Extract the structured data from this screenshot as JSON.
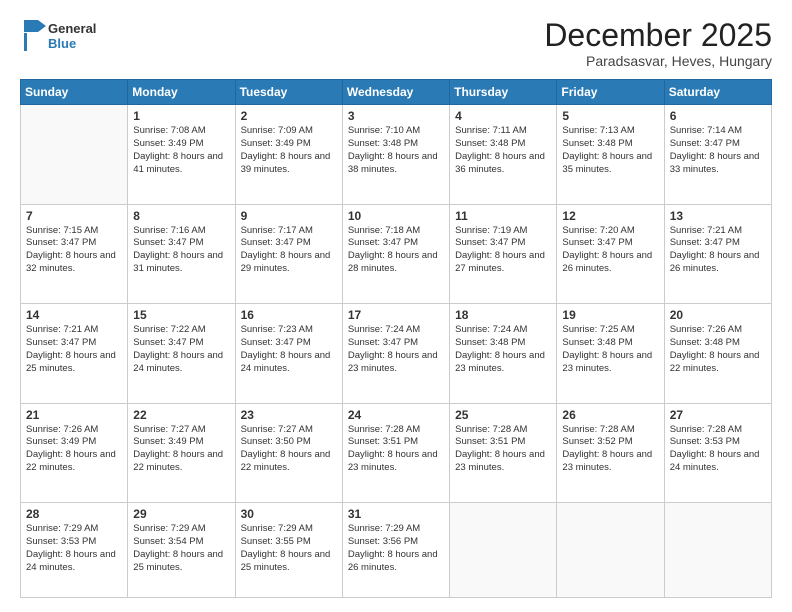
{
  "header": {
    "logo_line1": "General",
    "logo_line2": "Blue",
    "month": "December 2025",
    "location": "Paradsasvar, Heves, Hungary"
  },
  "weekdays": [
    "Sunday",
    "Monday",
    "Tuesday",
    "Wednesday",
    "Thursday",
    "Friday",
    "Saturday"
  ],
  "weeks": [
    [
      {
        "day": "",
        "sunrise": "",
        "sunset": "",
        "daylight": ""
      },
      {
        "day": "1",
        "sunrise": "Sunrise: 7:08 AM",
        "sunset": "Sunset: 3:49 PM",
        "daylight": "Daylight: 8 hours and 41 minutes."
      },
      {
        "day": "2",
        "sunrise": "Sunrise: 7:09 AM",
        "sunset": "Sunset: 3:49 PM",
        "daylight": "Daylight: 8 hours and 39 minutes."
      },
      {
        "day": "3",
        "sunrise": "Sunrise: 7:10 AM",
        "sunset": "Sunset: 3:48 PM",
        "daylight": "Daylight: 8 hours and 38 minutes."
      },
      {
        "day": "4",
        "sunrise": "Sunrise: 7:11 AM",
        "sunset": "Sunset: 3:48 PM",
        "daylight": "Daylight: 8 hours and 36 minutes."
      },
      {
        "day": "5",
        "sunrise": "Sunrise: 7:13 AM",
        "sunset": "Sunset: 3:48 PM",
        "daylight": "Daylight: 8 hours and 35 minutes."
      },
      {
        "day": "6",
        "sunrise": "Sunrise: 7:14 AM",
        "sunset": "Sunset: 3:47 PM",
        "daylight": "Daylight: 8 hours and 33 minutes."
      }
    ],
    [
      {
        "day": "7",
        "sunrise": "Sunrise: 7:15 AM",
        "sunset": "Sunset: 3:47 PM",
        "daylight": "Daylight: 8 hours and 32 minutes."
      },
      {
        "day": "8",
        "sunrise": "Sunrise: 7:16 AM",
        "sunset": "Sunset: 3:47 PM",
        "daylight": "Daylight: 8 hours and 31 minutes."
      },
      {
        "day": "9",
        "sunrise": "Sunrise: 7:17 AM",
        "sunset": "Sunset: 3:47 PM",
        "daylight": "Daylight: 8 hours and 29 minutes."
      },
      {
        "day": "10",
        "sunrise": "Sunrise: 7:18 AM",
        "sunset": "Sunset: 3:47 PM",
        "daylight": "Daylight: 8 hours and 28 minutes."
      },
      {
        "day": "11",
        "sunrise": "Sunrise: 7:19 AM",
        "sunset": "Sunset: 3:47 PM",
        "daylight": "Daylight: 8 hours and 27 minutes."
      },
      {
        "day": "12",
        "sunrise": "Sunrise: 7:20 AM",
        "sunset": "Sunset: 3:47 PM",
        "daylight": "Daylight: 8 hours and 26 minutes."
      },
      {
        "day": "13",
        "sunrise": "Sunrise: 7:21 AM",
        "sunset": "Sunset: 3:47 PM",
        "daylight": "Daylight: 8 hours and 26 minutes."
      }
    ],
    [
      {
        "day": "14",
        "sunrise": "Sunrise: 7:21 AM",
        "sunset": "Sunset: 3:47 PM",
        "daylight": "Daylight: 8 hours and 25 minutes."
      },
      {
        "day": "15",
        "sunrise": "Sunrise: 7:22 AM",
        "sunset": "Sunset: 3:47 PM",
        "daylight": "Daylight: 8 hours and 24 minutes."
      },
      {
        "day": "16",
        "sunrise": "Sunrise: 7:23 AM",
        "sunset": "Sunset: 3:47 PM",
        "daylight": "Daylight: 8 hours and 24 minutes."
      },
      {
        "day": "17",
        "sunrise": "Sunrise: 7:24 AM",
        "sunset": "Sunset: 3:47 PM",
        "daylight": "Daylight: 8 hours and 23 minutes."
      },
      {
        "day": "18",
        "sunrise": "Sunrise: 7:24 AM",
        "sunset": "Sunset: 3:48 PM",
        "daylight": "Daylight: 8 hours and 23 minutes."
      },
      {
        "day": "19",
        "sunrise": "Sunrise: 7:25 AM",
        "sunset": "Sunset: 3:48 PM",
        "daylight": "Daylight: 8 hours and 23 minutes."
      },
      {
        "day": "20",
        "sunrise": "Sunrise: 7:26 AM",
        "sunset": "Sunset: 3:48 PM",
        "daylight": "Daylight: 8 hours and 22 minutes."
      }
    ],
    [
      {
        "day": "21",
        "sunrise": "Sunrise: 7:26 AM",
        "sunset": "Sunset: 3:49 PM",
        "daylight": "Daylight: 8 hours and 22 minutes."
      },
      {
        "day": "22",
        "sunrise": "Sunrise: 7:27 AM",
        "sunset": "Sunset: 3:49 PM",
        "daylight": "Daylight: 8 hours and 22 minutes."
      },
      {
        "day": "23",
        "sunrise": "Sunrise: 7:27 AM",
        "sunset": "Sunset: 3:50 PM",
        "daylight": "Daylight: 8 hours and 22 minutes."
      },
      {
        "day": "24",
        "sunrise": "Sunrise: 7:28 AM",
        "sunset": "Sunset: 3:51 PM",
        "daylight": "Daylight: 8 hours and 23 minutes."
      },
      {
        "day": "25",
        "sunrise": "Sunrise: 7:28 AM",
        "sunset": "Sunset: 3:51 PM",
        "daylight": "Daylight: 8 hours and 23 minutes."
      },
      {
        "day": "26",
        "sunrise": "Sunrise: 7:28 AM",
        "sunset": "Sunset: 3:52 PM",
        "daylight": "Daylight: 8 hours and 23 minutes."
      },
      {
        "day": "27",
        "sunrise": "Sunrise: 7:28 AM",
        "sunset": "Sunset: 3:53 PM",
        "daylight": "Daylight: 8 hours and 24 minutes."
      }
    ],
    [
      {
        "day": "28",
        "sunrise": "Sunrise: 7:29 AM",
        "sunset": "Sunset: 3:53 PM",
        "daylight": "Daylight: 8 hours and 24 minutes."
      },
      {
        "day": "29",
        "sunrise": "Sunrise: 7:29 AM",
        "sunset": "Sunset: 3:54 PM",
        "daylight": "Daylight: 8 hours and 25 minutes."
      },
      {
        "day": "30",
        "sunrise": "Sunrise: 7:29 AM",
        "sunset": "Sunset: 3:55 PM",
        "daylight": "Daylight: 8 hours and 25 minutes."
      },
      {
        "day": "31",
        "sunrise": "Sunrise: 7:29 AM",
        "sunset": "Sunset: 3:56 PM",
        "daylight": "Daylight: 8 hours and 26 minutes."
      },
      {
        "day": "",
        "sunrise": "",
        "sunset": "",
        "daylight": ""
      },
      {
        "day": "",
        "sunrise": "",
        "sunset": "",
        "daylight": ""
      },
      {
        "day": "",
        "sunrise": "",
        "sunset": "",
        "daylight": ""
      }
    ]
  ]
}
